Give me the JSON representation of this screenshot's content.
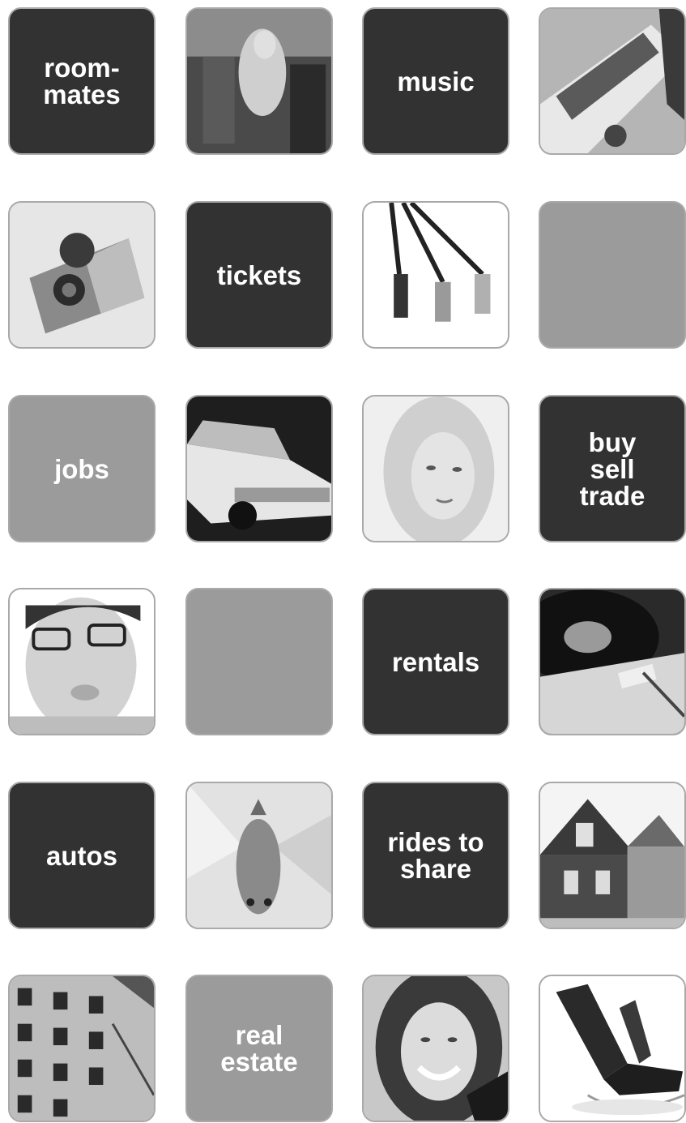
{
  "tiles": {
    "roommates": "room-\nmates",
    "music": "music",
    "tickets": "tickets",
    "jobs": "jobs",
    "buy_sell_trade": "buy\nsell\ntrade",
    "rentals": "rentals",
    "autos": "autos",
    "rides_to_share": "rides to\nshare",
    "real_estate": "real\nestate"
  },
  "photos": [
    "concert-photo",
    "guitar-photo",
    "camera-photo",
    "rca-cables-photo",
    "classic-car-photo",
    "woman-portrait-photo",
    "man-glasses-photo",
    "turntable-photo",
    "goldfish-photo",
    "victorian-house-photo",
    "apartment-building-photo",
    "smiling-woman-photo",
    "lounge-chair-photo"
  ],
  "colors": {
    "dark_tile": "#323232",
    "mid_tile": "#9b9b9b",
    "border": "#a9a9a9",
    "text": "#ffffff"
  }
}
